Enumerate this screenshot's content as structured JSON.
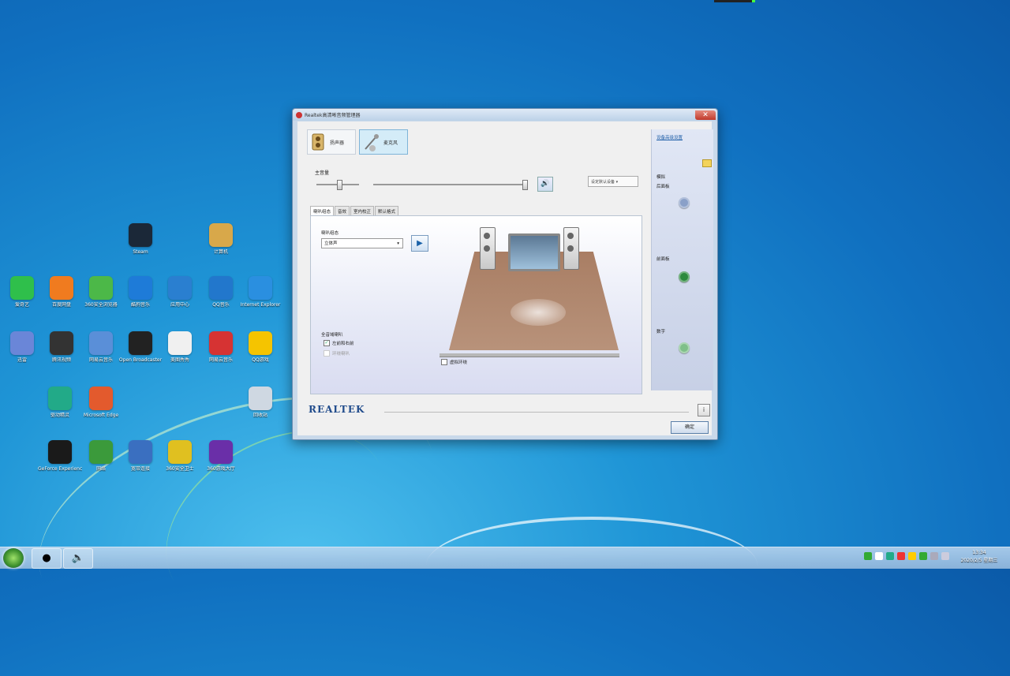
{
  "dialog": {
    "title": "Realtek高清晰音频管理器",
    "main_tabs": [
      {
        "label": "扬声器",
        "icon": "speaker-icon",
        "active": false
      },
      {
        "label": "麦克风",
        "icon": "microphone-icon",
        "active": true
      }
    ],
    "main_volume_label": "主音量",
    "device_select": "设定默认设备",
    "sub_tabs": [
      "喇叭组态",
      "音效",
      "室内校正",
      "默认格式"
    ],
    "speaker_config_label": "喇叭组态",
    "speaker_config_value": "立体声",
    "full_range_group_label": "全音域喇叭",
    "checkboxes": [
      {
        "label": "左前和右前",
        "checked": true,
        "enabled": true
      },
      {
        "label": "环绕喇叭",
        "checked": false,
        "enabled": false
      }
    ],
    "virtual_surround_label": "虚拟环绕",
    "sidebar": {
      "advanced_link": "设备高级设置",
      "jacks": [
        {
          "label": "模拟",
          "sub": "后面板",
          "color": "#8aa0c8"
        },
        {
          "label": "前面板",
          "color": "#2d8a3e"
        },
        {
          "label": "数字",
          "color": "#7fc089"
        }
      ]
    },
    "brand": "REALTEK",
    "info_button": "i",
    "ok_button": "确定",
    "close_symbol": "✕"
  },
  "desktop_icons": [
    {
      "label": "Steam",
      "color": "#1b2838"
    },
    {
      "label": "计算机",
      "color": "#d8a84a"
    },
    {
      "label": "爱奇艺",
      "color": "#2fbf4b"
    },
    {
      "label": "百度网盘",
      "color": "#f07b1f"
    },
    {
      "label": "360安全浏览器",
      "color": "#4cb848"
    },
    {
      "label": "酷狗音乐",
      "color": "#1e7bd8"
    },
    {
      "label": "应用中心",
      "color": "#2a7fd0"
    },
    {
      "label": "QQ音乐",
      "color": "#2277cc"
    },
    {
      "label": "Internet Explorer",
      "color": "#2a8fe0"
    },
    {
      "label": "迅雷",
      "color": "#6a86d8"
    },
    {
      "label": "腾讯视频",
      "color": "#333333"
    },
    {
      "label": "网易云音乐",
      "color": "#5a8fd8"
    },
    {
      "label": "Open Broadcaster",
      "color": "#222222"
    },
    {
      "label": "美图秀秀",
      "color": "#f0f0f0"
    },
    {
      "label": "网易云音乐",
      "color": "#d63333"
    },
    {
      "label": "QQ游戏",
      "color": "#f5c400"
    },
    {
      "label": "驱动精灵",
      "color": "#22aa88"
    },
    {
      "label": "Microsoft Edge",
      "color": "#e35a2d"
    },
    {
      "label": "回收站",
      "color": "#cfd8e2"
    },
    {
      "label": "GeForce Experience",
      "color": "#1a1a1a"
    },
    {
      "label": "网络",
      "color": "#3b9a3b"
    },
    {
      "label": "宽带连接",
      "color": "#3a6fc0"
    },
    {
      "label": "360安全卫士",
      "color": "#e0c020"
    },
    {
      "label": "360游戏大厅",
      "color": "#6a2fa8"
    }
  ],
  "taskbar": {
    "clock_time": "13:34",
    "clock_date": "2020/2/5 星期三"
  }
}
